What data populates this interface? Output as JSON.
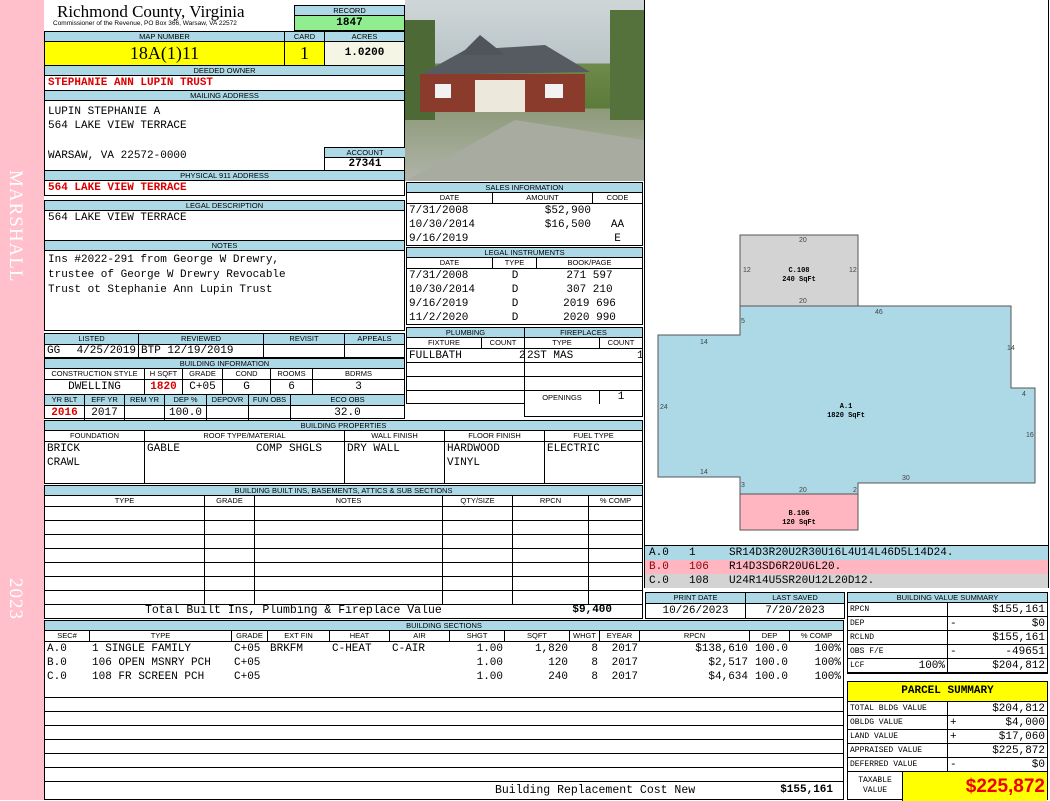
{
  "side": {
    "name": "MARSHALL",
    "year": "2023"
  },
  "header": {
    "county": "Richmond County, Virginia",
    "office": "Commissioner of the Revenue, PO Box 366, Warsaw, VA 22572",
    "record_label": "RECORD",
    "record": "1847"
  },
  "map": {
    "map_label": "MAP NUMBER",
    "map_number": "18A(1)11",
    "card_label": "CARD",
    "card": "1",
    "acres_label": "ACRES",
    "acres": "1.0200"
  },
  "owner": {
    "label": "DEEDED OWNER",
    "value": "STEPHANIE ANN LUPIN TRUST"
  },
  "mailing": {
    "label": "MAILING ADDRESS",
    "lines": [
      "LUPIN STEPHANIE A",
      "564 LAKE VIEW TERRACE",
      "WARSAW, VA 22572-0000"
    ]
  },
  "account": {
    "label": "ACCOUNT",
    "value": "27341"
  },
  "physical": {
    "label": "PHYSICAL 911 ADDRESS",
    "value": "564 LAKE VIEW TERRACE"
  },
  "legal": {
    "label": "LEGAL DESCRIPTION",
    "value": "564 LAKE VIEW TERRACE"
  },
  "notes": {
    "label": "NOTES",
    "lines": [
      "Ins #2022-291 from George W Drewry,",
      "trustee of George W Drewry Revocable",
      "Trust ot Stephanie Ann Lupin Trust"
    ]
  },
  "sales": {
    "label": "SALES INFORMATION",
    "cols": [
      "DATE",
      "AMOUNT",
      "CODE"
    ],
    "rows": [
      [
        "7/31/2008",
        "$52,900",
        ""
      ],
      [
        "10/30/2014",
        "$16,500",
        "AA"
      ],
      [
        "9/16/2019",
        "",
        "E"
      ]
    ]
  },
  "instruments": {
    "label": "LEGAL INSTRUMENTS",
    "cols": [
      "DATE",
      "TYPE",
      "BOOK/PAGE"
    ],
    "rows": [
      [
        "7/31/2008",
        "D",
        "271 597"
      ],
      [
        "10/30/2014",
        "D",
        "307 210"
      ],
      [
        "9/16/2019",
        "D",
        "2019 696"
      ],
      [
        "11/2/2020",
        "D",
        "2020 990"
      ]
    ]
  },
  "listed": {
    "cols": [
      "LISTED",
      "REVIEWED",
      "REVISIT",
      "APPEALS"
    ],
    "listed_by": "GG",
    "listed_date": "4/25/2019",
    "reviewed_by": "BTP",
    "reviewed_date": "12/19/2019"
  },
  "building_info": {
    "label": "BUILDING INFORMATION",
    "cols1": [
      "CONSTRUCTION STYLE",
      "H SQFT",
      "GRADE",
      "COND",
      "ROOMS",
      "BDRMS"
    ],
    "vals1": [
      "DWELLING",
      "1820",
      "C+05",
      "G",
      "6",
      "3"
    ],
    "cols2": [
      "YR BLT",
      "EFF YR",
      "REM YR",
      "DEP %",
      "DEPOVR",
      "FUN OBS",
      "ECO OBS"
    ],
    "vals2": [
      "2016",
      "2017",
      "",
      "100.0",
      "",
      "",
      "32.0"
    ]
  },
  "plumbing": {
    "label": "PLUMBING",
    "cols": [
      "FIXTURE",
      "COUNT"
    ],
    "rows": [
      [
        "FULLBATH",
        "2"
      ]
    ]
  },
  "fireplaces": {
    "label": "FIREPLACES",
    "cols": [
      "TYPE",
      "COUNT"
    ],
    "rows": [
      [
        "2ST MAS",
        "1"
      ]
    ],
    "openings_label": "OPENINGS",
    "openings": "1"
  },
  "properties": {
    "label": "BUILDING PROPERTIES",
    "cols": [
      "FOUNDATION",
      "ROOF TYPE/MATERIAL",
      "WALL FINISH",
      "FLOOR FINISH",
      "FUEL TYPE"
    ],
    "foundation": [
      "BRICK",
      "CRAWL"
    ],
    "roof_type": "GABLE",
    "roof_material": "COMP SHGLS",
    "wall": [
      "DRY WALL"
    ],
    "floor": [
      "HARDWOOD",
      "VINYL"
    ],
    "fuel": [
      "ELECTRIC"
    ]
  },
  "builtins": {
    "label": "BUILDING BUILT INS, BASEMENTS, ATTICS & SUB SECTIONS",
    "cols": [
      "TYPE",
      "GRADE",
      "NOTES",
      "QTY/SIZE",
      "RPCN",
      "% COMP"
    ],
    "total_label": "Total Built Ins, Plumbing & Fireplace Value",
    "total": "$9,400"
  },
  "sections": {
    "label": "BUILDING SECTIONS",
    "cols": [
      "SEC#",
      "TYPE",
      "GRADE",
      "EXT FIN",
      "HEAT",
      "AIR",
      "SHGT",
      "SQFT",
      "WHGT",
      "EYEAR",
      "RPCN",
      "DEP",
      "% COMP"
    ],
    "rows": [
      [
        "A.0",
        "1 SINGLE FAMILY",
        "C+05",
        "BRKFM",
        "C-HEAT",
        "C-AIR",
        "1.00",
        "1,820",
        "8",
        "2017",
        "$138,610",
        "100.0",
        "100%"
      ],
      [
        "B.0",
        "106 OPEN MSNRY PCH",
        "C+05",
        "",
        "",
        "",
        "1.00",
        "120",
        "8",
        "2017",
        "$2,517",
        "100.0",
        "100%"
      ],
      [
        "C.0",
        "108 FR SCREEN PCH",
        "C+05",
        "",
        "",
        "",
        "1.00",
        "240",
        "8",
        "2017",
        "$4,634",
        "100.0",
        "100%"
      ]
    ],
    "total_label": "Building Replacement Cost New",
    "total": "$155,161"
  },
  "sketch": {
    "areas": [
      {
        "id": "A.1",
        "sqft": "1820 SqFt",
        "color": "#add8e6"
      },
      {
        "id": "B.106",
        "sqft": "120 SqFt",
        "color": "#ffb6c1"
      },
      {
        "id": "C.108",
        "sqft": "240 SqFt",
        "color": "#d3d3d3"
      }
    ],
    "dims": [
      "20",
      "12",
      "12",
      "20",
      "46",
      "5",
      "14",
      "14",
      "4",
      "24",
      "16",
      "14",
      "30",
      "3",
      "20",
      "2"
    ],
    "legend": [
      [
        "A.0",
        "1",
        "SR14D3R20U2R30U16L4U14L46D5L14D24."
      ],
      [
        "B.0",
        "106",
        "R14D3SD6R20U6L20."
      ],
      [
        "C.0",
        "108",
        "U24R14U5SR20U12L20D12."
      ]
    ]
  },
  "dates": {
    "print_label": "PRINT DATE",
    "print": "10/26/2023",
    "saved_label": "LAST SAVED",
    "saved": "7/20/2023"
  },
  "bvs": {
    "label": "BUILDING VALUE SUMMARY",
    "rows": [
      [
        "RPCN",
        "",
        "",
        "$155,161"
      ],
      [
        "DEP",
        "",
        "-",
        "$0"
      ],
      [
        "RCLND",
        "",
        "",
        "$155,161"
      ],
      [
        "OBS F/E",
        "",
        "-",
        "-49651"
      ],
      [
        "LCF",
        "100%",
        "",
        "$204,812"
      ]
    ]
  },
  "parcel": {
    "label": "PARCEL SUMMARY",
    "rows": [
      [
        "TOTAL BLDG VALUE",
        "",
        "$204,812"
      ],
      [
        "OBLDG VALUE",
        "+",
        "$4,000"
      ],
      [
        "LAND VALUE",
        "+",
        "$17,060"
      ],
      [
        "APPRAISED VALUE",
        "",
        "$225,872"
      ],
      [
        "DEFERRED VALUE",
        "-",
        "$0"
      ]
    ],
    "taxable_label": "TAXABLE VALUE",
    "taxable": "$225,872"
  },
  "colors": {
    "header": "#add8e6",
    "highlight": "#ffff00",
    "record": "#90ee90",
    "strip": "#ffc0cb",
    "red": "#dd0000"
  }
}
